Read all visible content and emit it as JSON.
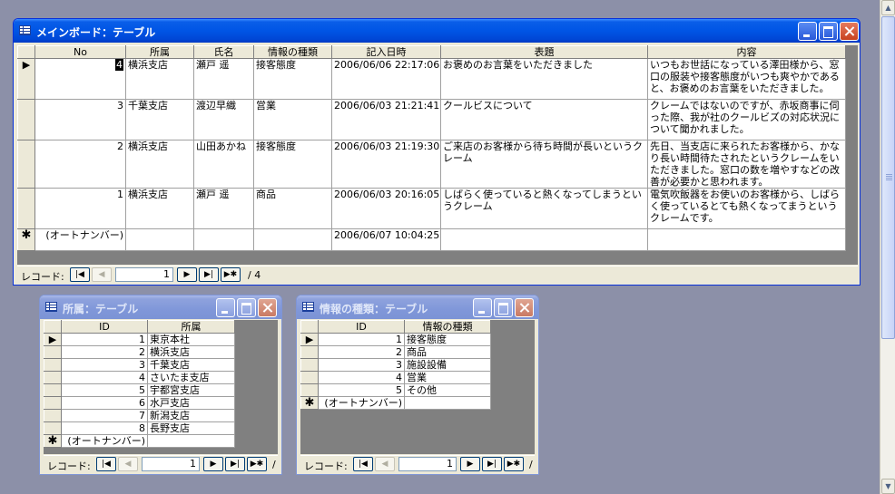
{
  "main_window": {
    "title": "メインボード：テーブル",
    "columns": [
      "No",
      "所属",
      "氏名",
      "情報の種類",
      "記入日時",
      "表題",
      "内容"
    ],
    "rows": [
      {
        "no": "4",
        "dept": "横浜支店",
        "name": "瀬戸 遥",
        "kind": "接客態度",
        "date": "2006/06/06 22:17:06",
        "subject": "お褒めのお言葉をいただきました",
        "content": "いつもお世話になっている澤田様から、窓口の服装や接客態度がいつも爽やかであると、お褒めのお言葉をいただきました。"
      },
      {
        "no": "3",
        "dept": "千葉支店",
        "name": "渡辺早織",
        "kind": "営業",
        "date": "2006/06/03 21:21:41",
        "subject": "クールビスについて",
        "content": "クレームではないのですが、赤坂商事に伺った際、我が社のクールビズの対応状況について聞かれました。"
      },
      {
        "no": "2",
        "dept": "横浜支店",
        "name": "山田あかね",
        "kind": "接客態度",
        "date": "2006/06/03 21:19:30",
        "subject": "ご来店のお客様から待ち時間が長いというクレーム",
        "content": "先日、当支店に来られたお客様から、かなり長い時間待たされたというクレームをいただきました。窓口の数を増やすなどの改善が必要かと思われます。"
      },
      {
        "no": "1",
        "dept": "横浜支店",
        "name": "瀬戸 遥",
        "kind": "商品",
        "date": "2006/06/03 20:16:05",
        "subject": "しばらく使っていると熱くなってしまうというクレーム",
        "content": "電気吹飯器をお使いのお客様から、しばらく使っているとても熱くなってまうというクレームです。"
      }
    ],
    "new_row": {
      "no": "(オートナンバー)",
      "date": "2006/06/07 10:04:25"
    },
    "nav": {
      "label": "レコード:",
      "current": "1",
      "total": "/ 4"
    }
  },
  "dept_window": {
    "title": "所属：テーブル",
    "columns": [
      "ID",
      "所属"
    ],
    "rows": [
      {
        "id": "1",
        "value": "東京本社"
      },
      {
        "id": "2",
        "value": "横浜支店"
      },
      {
        "id": "3",
        "value": "千葉支店"
      },
      {
        "id": "4",
        "value": "さいたま支店"
      },
      {
        "id": "5",
        "value": "宇都宮支店"
      },
      {
        "id": "6",
        "value": "水戸支店"
      },
      {
        "id": "7",
        "value": "新潟支店"
      },
      {
        "id": "8",
        "value": "長野支店"
      }
    ],
    "new_row": "(オートナンバー)",
    "nav": {
      "label": "レコード:",
      "current": "1",
      "total": "/"
    }
  },
  "kind_window": {
    "title": "情報の種類：テーブル",
    "columns": [
      "ID",
      "情報の種類"
    ],
    "rows": [
      {
        "id": "1",
        "value": "接客態度"
      },
      {
        "id": "2",
        "value": "商品"
      },
      {
        "id": "3",
        "value": "施設設備"
      },
      {
        "id": "4",
        "value": "営業"
      },
      {
        "id": "5",
        "value": "その他"
      }
    ],
    "new_row": "(オートナンバー)",
    "nav": {
      "label": "レコード:",
      "current": "1",
      "total": "/"
    }
  },
  "nav_symbols": {
    "first": "|◀",
    "prev": "◀",
    "next": "▶",
    "last": "▶|",
    "new": "▶✱"
  },
  "row_symbols": {
    "current": "▶",
    "new": "✱"
  },
  "colors": {
    "titlebar_active": "#0055e5",
    "titlebar_inactive": "#8097d9",
    "desktop": "#8c90a8"
  }
}
